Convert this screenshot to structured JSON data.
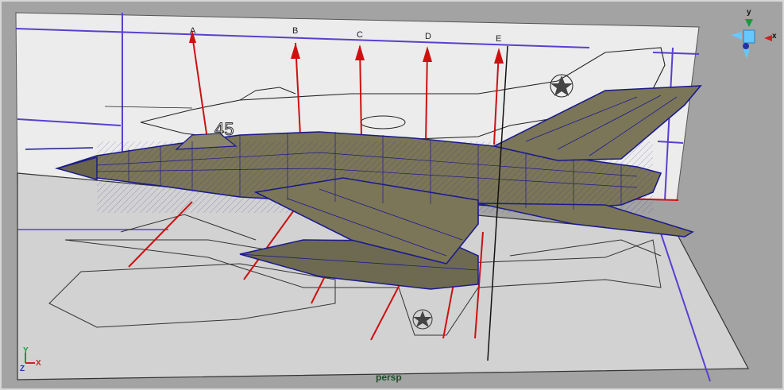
{
  "viewport": {
    "camera_label": "persp",
    "background_color": "#a3a3a3",
    "image_plane_markers": [
      "A",
      "B",
      "C",
      "D",
      "E"
    ],
    "blueprint_side_number": "45"
  },
  "view_cube": {
    "axis_y": "y",
    "axis_x": "x",
    "icon": "view-cube-icon"
  },
  "axis_gizmo": {
    "axis_y": "Y",
    "axis_x": "X",
    "axis_z": "Z",
    "icon": "world-axis-icon"
  },
  "colors": {
    "mesh_fill": "#7c7658",
    "mesh_wire": "#1a1a8c",
    "guide_lines": "#cc1111",
    "plane_border": "#5a3fd0"
  }
}
